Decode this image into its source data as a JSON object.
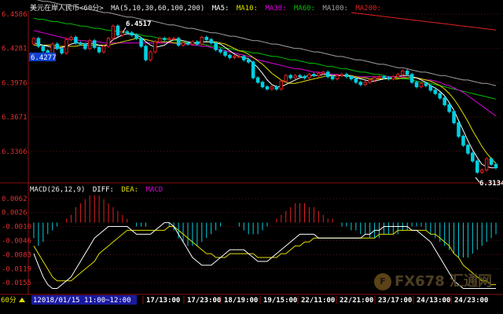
{
  "title_bar": {
    "instrument": "美元在岸人民币<60分>",
    "ma_spec": "MA(5,10,30,60,100,200)",
    "ma5": "MA5:",
    "ma10": "MA10:",
    "ma30": "MA30:",
    "ma60": "MA60:",
    "ma100": "MA100:",
    "ma200": "MA200:"
  },
  "macd_bar": {
    "spec": "MACD(26,12,9)",
    "diff": "DIFF:",
    "dea": "DEA:",
    "macd": "MACD"
  },
  "price_axis": [
    "6.4586",
    "6.4281",
    "6.3976",
    "6.3671",
    "6.3366"
  ],
  "macd_axis": [
    "0.0062",
    "0.0026",
    "-0.0010",
    "-0.0046",
    "-0.0083",
    "-0.0119",
    "-0.0155"
  ],
  "annotations": {
    "high_label": "6.4517",
    "current_label": "6.4277",
    "low_label": "6.3134"
  },
  "bottom_bar": {
    "period": "60分",
    "range_label": "12018/01/15 11:00~12:00",
    "dates": [
      "17/13:00",
      "17/23:00",
      "18/19:00",
      "19/15:00",
      "22/11:00",
      "22/21:00",
      "23/17:00",
      "24/13:00",
      "24/23:00"
    ]
  },
  "watermark": {
    "badge": "F",
    "text": "FX678 汇通网"
  },
  "colors": {
    "up": "#e02020",
    "down": "#00d0e0",
    "ma5": "#ffffff",
    "ma10": "#e0e000",
    "ma30": "#e000e0",
    "ma60": "#00c000",
    "ma100": "#a0a0a0",
    "ma200": "#e02020",
    "diff": "#ffffff",
    "dea": "#e0e000"
  },
  "chart_data": [
    {
      "type": "candlestick",
      "ylim": [
        6.3134,
        6.46
      ],
      "candles_close": [
        6.437,
        6.43,
        6.426,
        6.418,
        6.432,
        6.428,
        6.424,
        6.436,
        6.438,
        6.433,
        6.432,
        6.428,
        6.435,
        6.429,
        6.425,
        6.43,
        6.437,
        6.448,
        6.44,
        6.443,
        6.442,
        6.44,
        6.437,
        6.43,
        6.418,
        6.425,
        6.434,
        6.437,
        6.436,
        6.437,
        6.437,
        6.431,
        6.433,
        6.432,
        6.434,
        6.432,
        6.438,
        6.436,
        6.433,
        6.427,
        6.425,
        6.422,
        6.42,
        6.421,
        6.421,
        6.418,
        6.416,
        6.402,
        6.398,
        6.394,
        6.392,
        6.394,
        6.392,
        6.399,
        6.404,
        6.402,
        6.404,
        6.403,
        6.402,
        6.405,
        6.404,
        6.406,
        6.407,
        6.403,
        6.401,
        6.404,
        6.405,
        6.403,
        6.401,
        6.398,
        6.396,
        6.398,
        6.4,
        6.402,
        6.403,
        6.402,
        6.401,
        6.403,
        6.405,
        6.408,
        6.405,
        6.398,
        6.394,
        6.397,
        6.395,
        6.391,
        6.388,
        6.384,
        6.378,
        6.372,
        6.362,
        6.35,
        6.342,
        6.335,
        6.328,
        6.318,
        6.32,
        6.33,
        6.325,
        6.322
      ],
      "candles_open": [
        6.432,
        6.437,
        6.43,
        6.426,
        6.418,
        6.432,
        6.428,
        6.424,
        6.436,
        6.438,
        6.433,
        6.432,
        6.428,
        6.435,
        6.429,
        6.425,
        6.43,
        6.437,
        6.448,
        6.44,
        6.443,
        6.442,
        6.44,
        6.437,
        6.43,
        6.418,
        6.425,
        6.434,
        6.437,
        6.436,
        6.437,
        6.437,
        6.431,
        6.433,
        6.432,
        6.434,
        6.432,
        6.438,
        6.436,
        6.433,
        6.427,
        6.425,
        6.422,
        6.42,
        6.421,
        6.421,
        6.418,
        6.416,
        6.402,
        6.398,
        6.394,
        6.392,
        6.394,
        6.392,
        6.399,
        6.404,
        6.402,
        6.404,
        6.403,
        6.402,
        6.405,
        6.404,
        6.406,
        6.407,
        6.403,
        6.401,
        6.404,
        6.405,
        6.403,
        6.401,
        6.398,
        6.396,
        6.398,
        6.4,
        6.402,
        6.403,
        6.402,
        6.401,
        6.403,
        6.405,
        6.408,
        6.405,
        6.398,
        6.394,
        6.397,
        6.395,
        6.391,
        6.388,
        6.384,
        6.378,
        6.372,
        6.362,
        6.35,
        6.342,
        6.335,
        6.328,
        6.318,
        6.32,
        6.33,
        6.325
      ],
      "ma5": [
        6.433,
        6.432,
        6.431,
        6.43,
        6.429,
        6.428,
        6.429,
        6.43,
        6.432,
        6.433,
        6.433,
        6.432,
        6.433,
        6.432,
        6.431,
        6.43,
        6.432,
        6.436,
        6.438,
        6.44,
        6.441,
        6.441,
        6.44,
        6.438,
        6.434,
        6.431,
        6.429,
        6.43,
        6.431,
        6.434,
        6.436,
        6.436,
        6.435,
        6.434,
        6.433,
        6.433,
        6.434,
        6.434,
        6.434,
        6.433,
        6.432,
        6.429,
        6.426,
        6.423,
        6.421,
        6.42,
        6.419,
        6.415,
        6.411,
        6.406,
        6.4,
        6.396,
        6.394,
        6.394,
        6.396,
        6.398,
        6.4,
        6.402,
        6.403,
        6.404,
        6.404,
        6.404,
        6.405,
        6.405,
        6.404,
        6.404,
        6.404,
        6.404,
        6.403,
        6.402,
        6.401,
        6.4,
        6.399,
        6.399,
        6.4,
        6.401,
        6.402,
        6.402,
        6.403,
        6.404,
        6.404,
        6.403,
        6.402,
        6.4,
        6.398,
        6.395,
        6.393,
        6.39,
        6.386,
        6.38,
        6.373,
        6.364,
        6.355,
        6.346,
        6.338,
        6.331,
        6.325,
        6.323,
        6.322,
        6.322
      ],
      "ma10": [
        6.431,
        6.431,
        6.431,
        6.431,
        6.431,
        6.43,
        6.43,
        6.43,
        6.43,
        6.43,
        6.431,
        6.431,
        6.431,
        6.431,
        6.431,
        6.431,
        6.431,
        6.432,
        6.433,
        6.434,
        6.435,
        6.436,
        6.437,
        6.437,
        6.436,
        6.435,
        6.434,
        6.434,
        6.434,
        6.434,
        6.433,
        6.433,
        6.433,
        6.433,
        6.433,
        6.433,
        6.434,
        6.434,
        6.434,
        6.434,
        6.433,
        6.432,
        6.43,
        6.428,
        6.426,
        6.425,
        6.423,
        6.42,
        6.417,
        6.414,
        6.41,
        6.406,
        6.403,
        6.4,
        6.398,
        6.397,
        6.397,
        6.398,
        6.399,
        6.4,
        6.401,
        6.402,
        6.403,
        6.404,
        6.404,
        6.404,
        6.404,
        6.404,
        6.404,
        6.403,
        6.402,
        6.402,
        6.401,
        6.401,
        6.401,
        6.401,
        6.401,
        6.401,
        6.401,
        6.402,
        6.402,
        6.402,
        6.402,
        6.401,
        6.4,
        6.399,
        6.397,
        6.395,
        6.392,
        6.388,
        6.383,
        6.377,
        6.37,
        6.363,
        6.355,
        6.348,
        6.341,
        6.335,
        6.33,
        6.326
      ],
      "ma30": [
        6.444,
        6.443,
        6.442,
        6.441,
        6.44,
        6.439,
        6.438,
        6.437,
        6.436,
        6.436,
        6.435,
        6.435,
        6.434,
        6.434,
        6.434,
        6.433,
        6.433,
        6.433,
        6.433,
        6.433,
        6.433,
        6.433,
        6.433,
        6.433,
        6.433,
        6.433,
        6.433,
        6.433,
        6.433,
        6.433,
        6.433,
        6.432,
        6.432,
        6.432,
        6.431,
        6.431,
        6.43,
        6.43,
        6.429,
        6.428,
        6.427,
        6.426,
        6.425,
        6.424,
        6.423,
        6.422,
        6.421,
        6.42,
        6.418,
        6.417,
        6.416,
        6.415,
        6.414,
        6.413,
        6.412,
        6.411,
        6.41,
        6.41,
        6.409,
        6.408,
        6.407,
        6.407,
        6.406,
        6.406,
        6.405,
        6.405,
        6.404,
        6.404,
        6.404,
        6.403,
        6.403,
        6.403,
        6.403,
        6.403,
        6.403,
        6.403,
        6.403,
        6.403,
        6.403,
        6.403,
        6.402,
        6.402,
        6.402,
        6.401,
        6.4,
        6.4,
        6.399,
        6.398,
        6.396,
        6.395,
        6.393,
        6.391,
        6.389,
        6.386,
        6.383,
        6.38,
        6.377,
        6.374,
        6.371,
        6.368
      ],
      "ma60": [
        6.455,
        6.454,
        6.454,
        6.453,
        6.452,
        6.452,
        6.451,
        6.45,
        6.45,
        6.449,
        6.448,
        6.448,
        6.447,
        6.446,
        6.446,
        6.445,
        6.444,
        6.444,
        6.443,
        6.443,
        6.442,
        6.441,
        6.441,
        6.44,
        6.439,
        6.439,
        6.438,
        6.437,
        6.437,
        6.436,
        6.435,
        6.435,
        6.434,
        6.433,
        6.433,
        6.432,
        6.432,
        6.431,
        6.43,
        6.43,
        6.429,
        6.428,
        6.428,
        6.427,
        6.426,
        6.426,
        6.425,
        6.424,
        6.424,
        6.423,
        6.422,
        6.421,
        6.421,
        6.42,
        6.419,
        6.418,
        6.418,
        6.417,
        6.416,
        6.415,
        6.415,
        6.414,
        6.413,
        6.412,
        6.412,
        6.411,
        6.41,
        6.41,
        6.409,
        6.408,
        6.407,
        6.407,
        6.406,
        6.405,
        6.405,
        6.404,
        6.403,
        6.403,
        6.402,
        6.401,
        6.401,
        6.4,
        6.399,
        6.398,
        6.398,
        6.397,
        6.396,
        6.395,
        6.394,
        6.393,
        6.392,
        6.391,
        6.39,
        6.389,
        6.388,
        6.387,
        6.386,
        6.385,
        6.384,
        6.383
      ],
      "ma100": [
        6.472,
        6.471,
        6.47,
        6.47,
        6.469,
        6.468,
        6.467,
        6.467,
        6.466,
        6.465,
        6.464,
        6.463,
        6.463,
        6.462,
        6.461,
        6.46,
        6.46,
        6.459,
        6.458,
        6.457,
        6.456,
        6.456,
        6.455,
        6.454,
        6.453,
        6.453,
        6.452,
        6.451,
        6.45,
        6.449,
        6.449,
        6.448,
        6.447,
        6.446,
        6.446,
        6.445,
        6.444,
        6.443,
        6.442,
        6.442,
        6.441,
        6.44,
        6.439,
        6.439,
        6.438,
        6.437,
        6.436,
        6.435,
        6.435,
        6.434,
        6.433,
        6.432,
        6.432,
        6.431,
        6.43,
        6.429,
        6.428,
        6.428,
        6.427,
        6.426,
        6.425,
        6.425,
        6.424,
        6.423,
        6.422,
        6.421,
        6.421,
        6.42,
        6.419,
        6.418,
        6.418,
        6.417,
        6.416,
        6.415,
        6.414,
        6.414,
        6.413,
        6.412,
        6.411,
        6.411,
        6.41,
        6.409,
        6.408,
        6.407,
        6.407,
        6.406,
        6.405,
        6.404,
        6.404,
        6.403,
        6.402,
        6.401,
        6.4,
        6.4,
        6.399,
        6.398,
        6.397,
        6.397,
        6.396,
        6.395
      ],
      "ma200_visible_from_index": 68,
      "ma200": [
        6.46,
        6.4595,
        6.459,
        6.4585,
        6.458,
        6.4575,
        6.457,
        6.4565,
        6.456,
        6.4555,
        6.455,
        6.4545,
        6.454,
        6.4535,
        6.453,
        6.4525,
        6.452,
        6.4515,
        6.451,
        6.4505,
        6.45,
        6.4495,
        6.449,
        6.4485,
        6.448,
        6.4475,
        6.447,
        6.4465,
        6.446,
        6.4455,
        6.445,
        6.4445
      ]
    },
    {
      "type": "macd",
      "ylim": [
        -0.0175,
        0.0072
      ],
      "histogram": [
        -0.004,
        -0.006,
        -0.005,
        -0.003,
        -0.002,
        -0.001,
        0.0,
        0.001,
        0.002,
        0.004,
        0.005,
        0.006,
        0.007,
        0.007,
        0.007,
        0.006,
        0.005,
        0.004,
        0.003,
        0.002,
        0.001,
        0.0,
        -0.001,
        -0.001,
        -0.001,
        0.0,
        0.0,
        0.0,
        0.0,
        -0.001,
        -0.002,
        -0.004,
        -0.005,
        -0.006,
        -0.006,
        -0.006,
        -0.005,
        -0.004,
        -0.003,
        -0.002,
        -0.001,
        0.0,
        0.0,
        0.0,
        -0.001,
        -0.002,
        -0.003,
        -0.003,
        -0.003,
        -0.002,
        -0.001,
        0.0,
        0.001,
        0.002,
        0.003,
        0.004,
        0.005,
        0.005,
        0.005,
        0.004,
        0.004,
        0.003,
        0.002,
        0.001,
        0.001,
        0.0,
        -0.001,
        -0.001,
        -0.002,
        -0.002,
        -0.003,
        -0.003,
        -0.004,
        -0.004,
        -0.004,
        -0.003,
        -0.003,
        -0.003,
        -0.003,
        -0.002,
        -0.002,
        -0.001,
        -0.001,
        -0.001,
        -0.002,
        -0.003,
        -0.004,
        -0.005,
        -0.006,
        -0.007,
        -0.008,
        -0.009,
        -0.009,
        -0.009,
        -0.008,
        -0.007,
        -0.006,
        -0.005,
        -0.004,
        -0.003
      ],
      "diff": [
        -0.008,
        -0.011,
        -0.014,
        -0.016,
        -0.017,
        -0.017,
        -0.016,
        -0.015,
        -0.014,
        -0.012,
        -0.01,
        -0.008,
        -0.006,
        -0.004,
        -0.003,
        -0.002,
        -0.001,
        -0.001,
        -0.001,
        -0.001,
        -0.001,
        -0.002,
        -0.003,
        -0.003,
        -0.003,
        -0.003,
        -0.002,
        -0.001,
        0.0,
        0.0,
        -0.001,
        -0.003,
        -0.005,
        -0.007,
        -0.009,
        -0.01,
        -0.011,
        -0.011,
        -0.011,
        -0.01,
        -0.009,
        -0.008,
        -0.007,
        -0.007,
        -0.007,
        -0.007,
        -0.008,
        -0.009,
        -0.01,
        -0.01,
        -0.01,
        -0.009,
        -0.008,
        -0.007,
        -0.006,
        -0.005,
        -0.004,
        -0.003,
        -0.003,
        -0.003,
        -0.003,
        -0.004,
        -0.004,
        -0.004,
        -0.004,
        -0.004,
        -0.004,
        -0.004,
        -0.004,
        -0.004,
        -0.004,
        -0.003,
        -0.003,
        -0.002,
        -0.002,
        -0.001,
        -0.001,
        -0.001,
        -0.001,
        -0.001,
        -0.001,
        -0.002,
        -0.002,
        -0.003,
        -0.004,
        -0.005,
        -0.007,
        -0.009,
        -0.011,
        -0.013,
        -0.015,
        -0.016,
        -0.017,
        -0.017,
        -0.017,
        -0.017,
        -0.017,
        -0.017,
        -0.017,
        -0.017
      ],
      "dea": [
        -0.006,
        -0.008,
        -0.01,
        -0.012,
        -0.014,
        -0.015,
        -0.015,
        -0.015,
        -0.015,
        -0.014,
        -0.013,
        -0.012,
        -0.011,
        -0.01,
        -0.008,
        -0.007,
        -0.006,
        -0.005,
        -0.004,
        -0.003,
        -0.002,
        -0.002,
        -0.002,
        -0.002,
        -0.002,
        -0.002,
        -0.002,
        -0.002,
        -0.002,
        -0.001,
        -0.001,
        -0.002,
        -0.003,
        -0.004,
        -0.005,
        -0.006,
        -0.007,
        -0.008,
        -0.008,
        -0.009,
        -0.009,
        -0.009,
        -0.008,
        -0.008,
        -0.008,
        -0.008,
        -0.008,
        -0.008,
        -0.009,
        -0.009,
        -0.009,
        -0.009,
        -0.009,
        -0.008,
        -0.008,
        -0.007,
        -0.006,
        -0.006,
        -0.005,
        -0.005,
        -0.004,
        -0.004,
        -0.004,
        -0.004,
        -0.004,
        -0.004,
        -0.004,
        -0.004,
        -0.004,
        -0.004,
        -0.004,
        -0.004,
        -0.004,
        -0.004,
        -0.003,
        -0.003,
        -0.003,
        -0.003,
        -0.002,
        -0.002,
        -0.002,
        -0.002,
        -0.002,
        -0.002,
        -0.002,
        -0.003,
        -0.003,
        -0.004,
        -0.005,
        -0.006,
        -0.008,
        -0.009,
        -0.011,
        -0.012,
        -0.013,
        -0.014,
        -0.015,
        -0.015,
        -0.016,
        -0.016
      ]
    }
  ]
}
